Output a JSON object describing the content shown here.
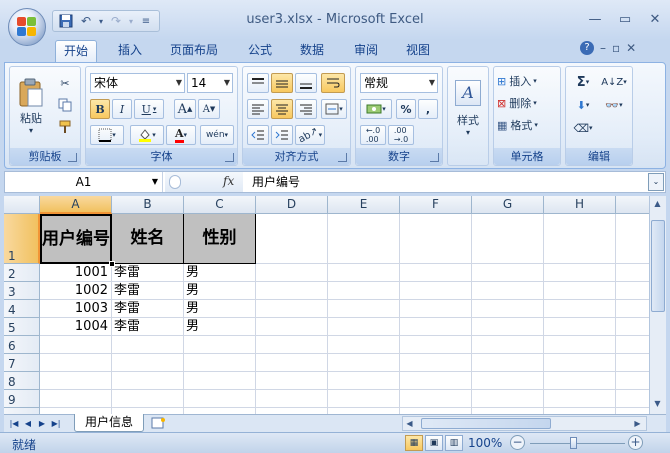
{
  "window": {
    "title": "user3.xlsx - Microsoft Excel"
  },
  "tabs": [
    "开始",
    "插入",
    "页面布局",
    "公式",
    "数据",
    "审阅",
    "视图"
  ],
  "ribbon": {
    "clipboard": {
      "label": "剪贴板",
      "paste": "粘贴"
    },
    "font": {
      "label": "字体",
      "name": "宋体",
      "size": "14",
      "bold": "B",
      "italic": "I",
      "underline": "U",
      "grow": "A",
      "shrink": "A"
    },
    "alignment": {
      "label": "对齐方式"
    },
    "number": {
      "label": "数字",
      "format": "常规",
      "percent": "%",
      "comma": ","
    },
    "styles": {
      "label": "样式"
    },
    "cells": {
      "label": "单元格",
      "insert": "插入",
      "delete": "删除",
      "format": "格式"
    },
    "editing": {
      "label": "编辑",
      "sum": "Σ"
    }
  },
  "formula_bar": {
    "name_box": "A1",
    "fx": "fx",
    "content": "用户编号"
  },
  "columns": [
    "A",
    "B",
    "C",
    "D",
    "E",
    "F",
    "G",
    "H"
  ],
  "rows": [
    "1",
    "2",
    "3",
    "4",
    "5",
    "6",
    "7",
    "8",
    "9"
  ],
  "headers": [
    "用户编号",
    "姓名",
    "性别"
  ],
  "data_rows": [
    [
      "1001",
      "李雷",
      "男"
    ],
    [
      "1002",
      "李雷",
      "男"
    ],
    [
      "1003",
      "李雷",
      "男"
    ],
    [
      "1004",
      "李雷",
      "男"
    ]
  ],
  "sheet_tab": "用户信息",
  "status": {
    "ready": "就绪",
    "zoom": "100%"
  },
  "colors": {
    "header_fill": "#c0c0c0",
    "accent": "#f29536"
  }
}
